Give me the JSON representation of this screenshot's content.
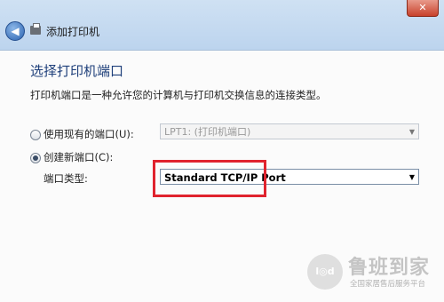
{
  "window": {
    "title": "添加打印机",
    "close_label": "✕",
    "back_label": "◀"
  },
  "page": {
    "title": "选择打印机端口",
    "description": "打印机端口是一种允许您的计算机与打印机交换信息的连接类型。"
  },
  "options": {
    "existing_port": {
      "label": "使用现有的端口(U):",
      "value": "LPT1: (打印机端口)",
      "selected": false
    },
    "new_port": {
      "label": "创建新端口(C):",
      "selected": true,
      "type_label": "端口类型:",
      "type_value": "Standard TCP/IP Port"
    }
  },
  "watermark": {
    "logo_mark": "l◎d",
    "brand": "鲁班到家",
    "tagline": "全国家居售后服务平台"
  },
  "colors": {
    "title_blue": "#1e3f7a",
    "highlight_red": "#e0232e"
  }
}
